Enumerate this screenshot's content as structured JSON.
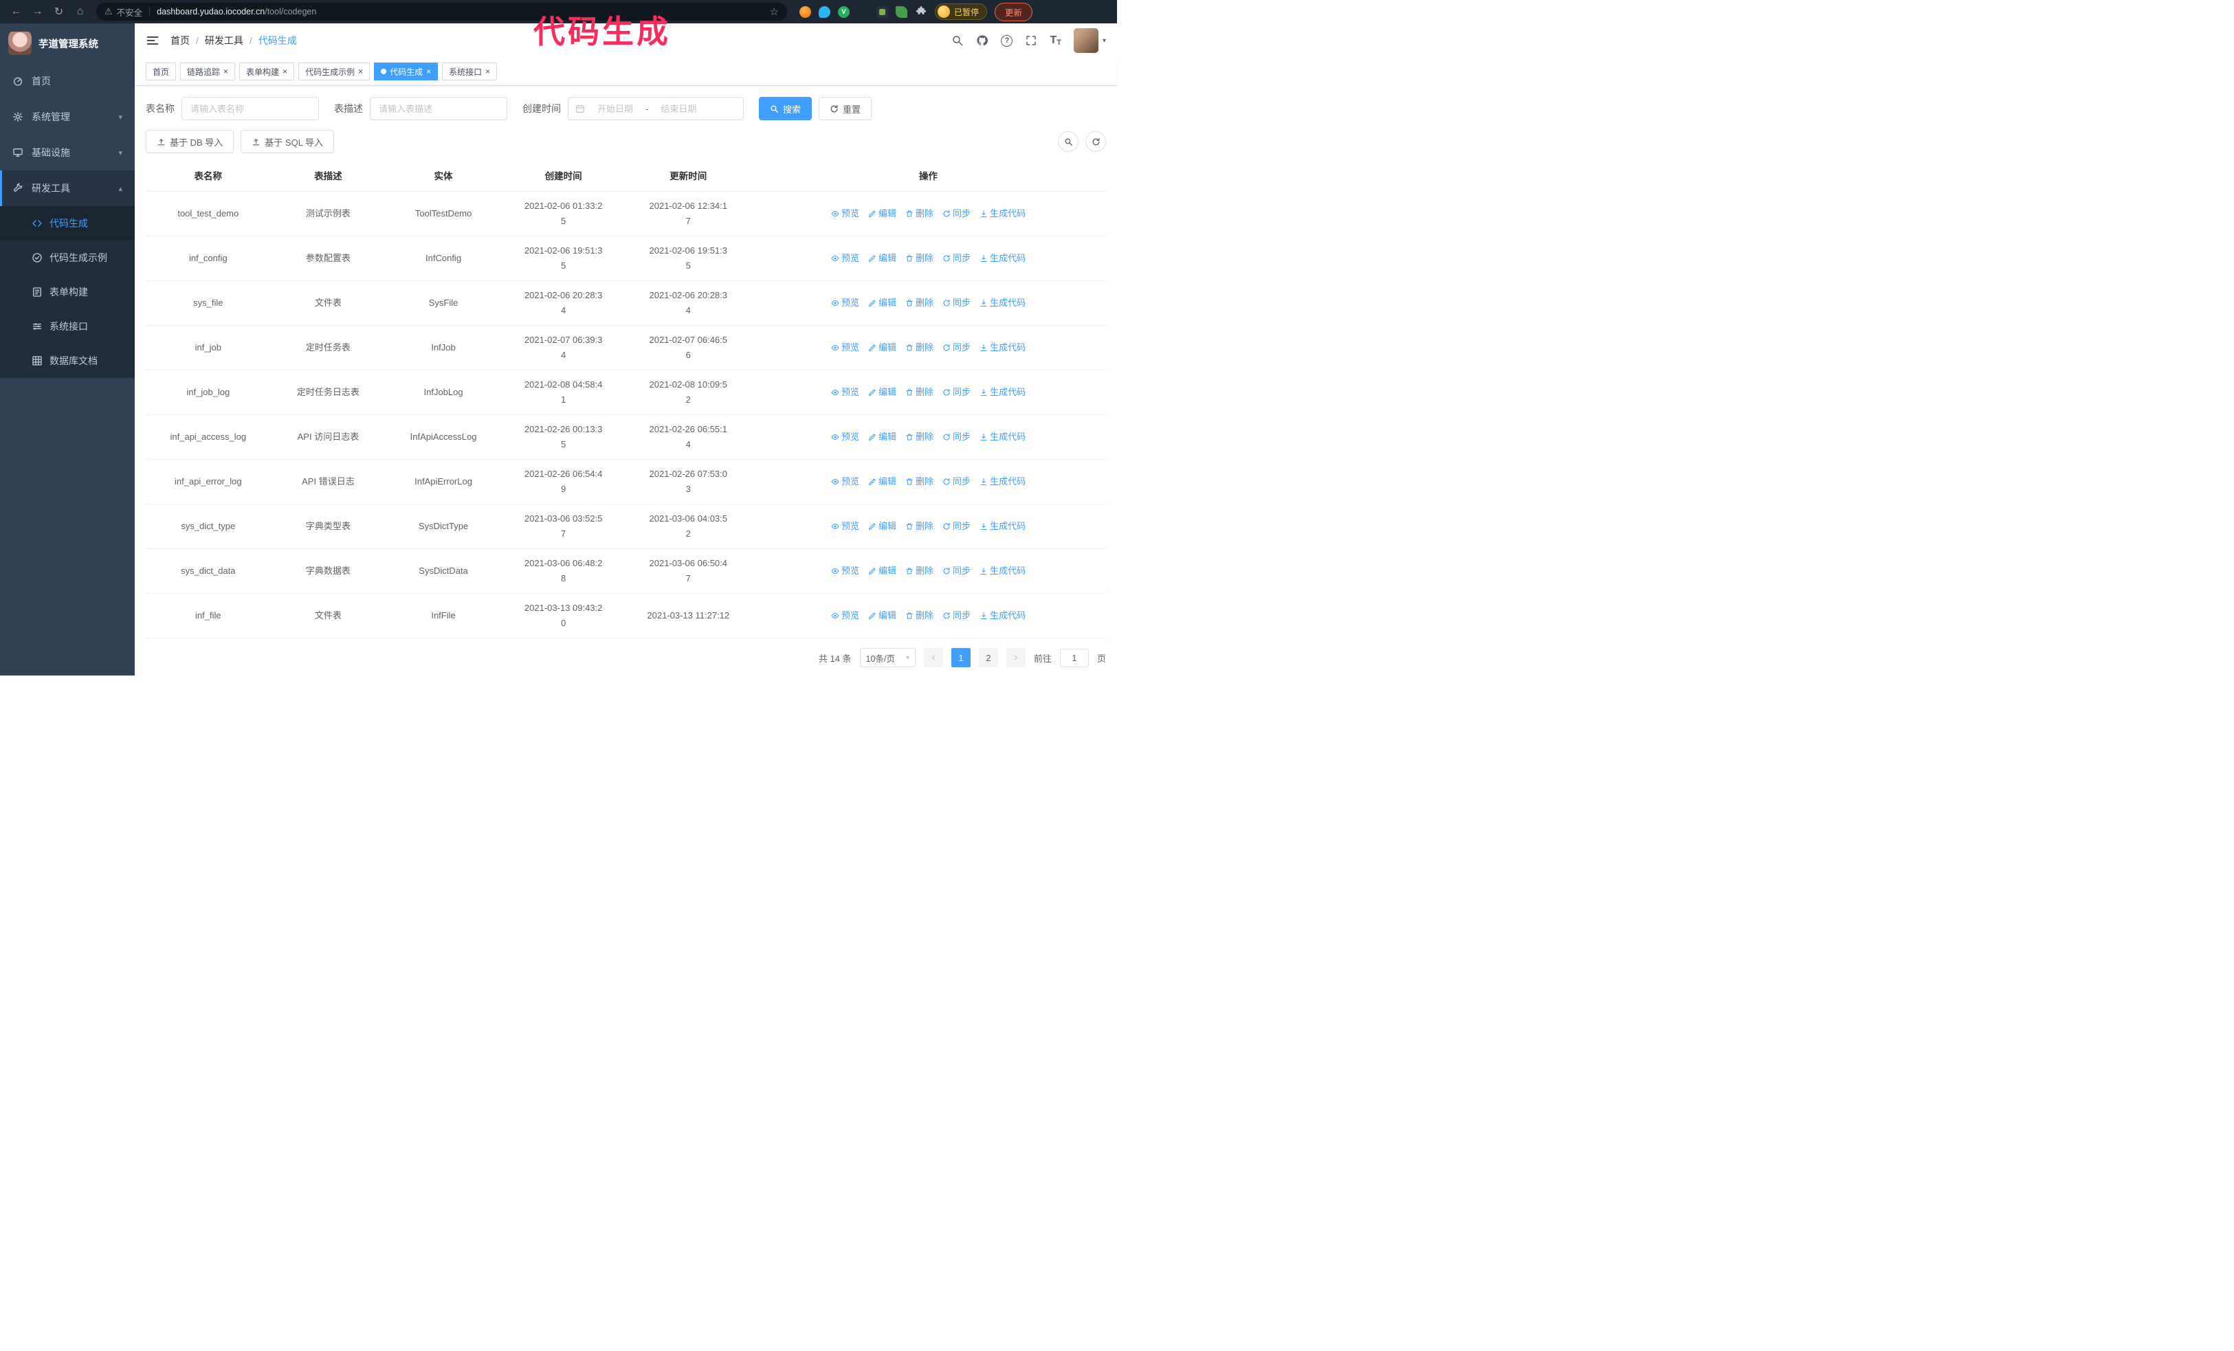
{
  "annotation": {
    "text": "代码生成"
  },
  "colors": {
    "primary": "#409eff",
    "annotation_pink": "#fa2c5c",
    "sidebar_bg": "#304156",
    "sidebar_submenu_bg": "#1f2d3d",
    "tab_active_bg": "#409eff",
    "update_button_red": "#e8694f",
    "paused_badge_yellow": "#fdd663"
  },
  "icons": {
    "back": "←",
    "forward": "→",
    "reload": "↻",
    "home": "⌂",
    "warning": "⚠",
    "star": "☆",
    "close": "×",
    "caret_down": "▾",
    "caret_up": "▴",
    "prev": "‹",
    "next": "›",
    "help": "?",
    "font_size": "T",
    "extension_v": "V",
    "sync": "↻"
  },
  "browser": {
    "security_label": "不安全",
    "url_host": "dashboard.yudao.iocoder.cn",
    "url_path": "/tool/codegen",
    "paused_badge": "已暂停",
    "update_button": "更新"
  },
  "app_title": "芋道管理系统",
  "sidebar": {
    "items": [
      {
        "label": "首页"
      },
      {
        "label": "系统管理"
      },
      {
        "label": "基础设施"
      },
      {
        "label": "研发工具"
      }
    ],
    "submenu": [
      {
        "label": "代码生成"
      },
      {
        "label": "代码生成示例"
      },
      {
        "label": "表单构建"
      },
      {
        "label": "系统接口"
      },
      {
        "label": "数据库文档"
      }
    ]
  },
  "breadcrumb": {
    "separator": "/",
    "items": [
      "首页",
      "研发工具",
      "代码生成"
    ]
  },
  "tabs": [
    {
      "label": "首页"
    },
    {
      "label": "链路追踪"
    },
    {
      "label": "表单构建"
    },
    {
      "label": "代码生成示例"
    },
    {
      "label": "代码生成"
    },
    {
      "label": "系统接口"
    }
  ],
  "filters": {
    "table_name_label": "表名称",
    "table_name_placeholder": "请输入表名称",
    "table_desc_label": "表描述",
    "table_desc_placeholder": "请输入表描述",
    "create_time_label": "创建时间",
    "date_start_placeholder": "开始日期",
    "date_separator": "-",
    "date_end_placeholder": "结束日期",
    "search_button": "搜索",
    "reset_button": "重置"
  },
  "toolbar": {
    "import_db_button": "基于 DB 导入",
    "import_sql_button": "基于 SQL 导入"
  },
  "table": {
    "headers": [
      "表名称",
      "表描述",
      "实体",
      "创建时间",
      "更新时间",
      "操作"
    ],
    "row_actions": [
      "预览",
      "编辑",
      "删除",
      "同步",
      "生成代码"
    ],
    "rows": [
      {
        "name": "tool_test_demo",
        "desc": "测试示例表",
        "entity": "ToolTestDemo",
        "created": "2021-02-06 01:33:25",
        "updated": "2021-02-06 12:34:17"
      },
      {
        "name": "inf_config",
        "desc": "参数配置表",
        "entity": "InfConfig",
        "created": "2021-02-06 19:51:35",
        "updated": "2021-02-06 19:51:35"
      },
      {
        "name": "sys_file",
        "desc": "文件表",
        "entity": "SysFile",
        "created": "2021-02-06 20:28:34",
        "updated": "2021-02-06 20:28:34"
      },
      {
        "name": "inf_job",
        "desc": "定时任务表",
        "entity": "InfJob",
        "created": "2021-02-07 06:39:34",
        "updated": "2021-02-07 06:46:56"
      },
      {
        "name": "inf_job_log",
        "desc": "定时任务日志表",
        "entity": "InfJobLog",
        "created": "2021-02-08 04:58:41",
        "updated": "2021-02-08 10:09:52"
      },
      {
        "name": "inf_api_access_log",
        "desc": "API 访问日志表",
        "entity": "InfApiAccessLog",
        "created": "2021-02-26 00:13:35",
        "updated": "2021-02-26 06:55:14"
      },
      {
        "name": "inf_api_error_log",
        "desc": "API 错误日志",
        "entity": "InfApiErrorLog",
        "created": "2021-02-26 06:54:49",
        "updated": "2021-02-26 07:53:03"
      },
      {
        "name": "sys_dict_type",
        "desc": "字典类型表",
        "entity": "SysDictType",
        "created": "2021-03-06 03:52:57",
        "updated": "2021-03-06 04:03:52"
      },
      {
        "name": "sys_dict_data",
        "desc": "字典数据表",
        "entity": "SysDictData",
        "created": "2021-03-06 06:48:28",
        "updated": "2021-03-06 06:50:47"
      },
      {
        "name": "inf_file",
        "desc": "文件表",
        "entity": "InfFile",
        "created": "2021-03-13 09:43:20",
        "updated": "2021-03-13 11:27:12"
      }
    ]
  },
  "pagination": {
    "total_text": "共 14 条",
    "page_size": "10条/页",
    "pages": [
      "1",
      "2"
    ],
    "active_page": "1",
    "goto_label": "前往",
    "goto_value": "1",
    "goto_suffix": "页"
  }
}
